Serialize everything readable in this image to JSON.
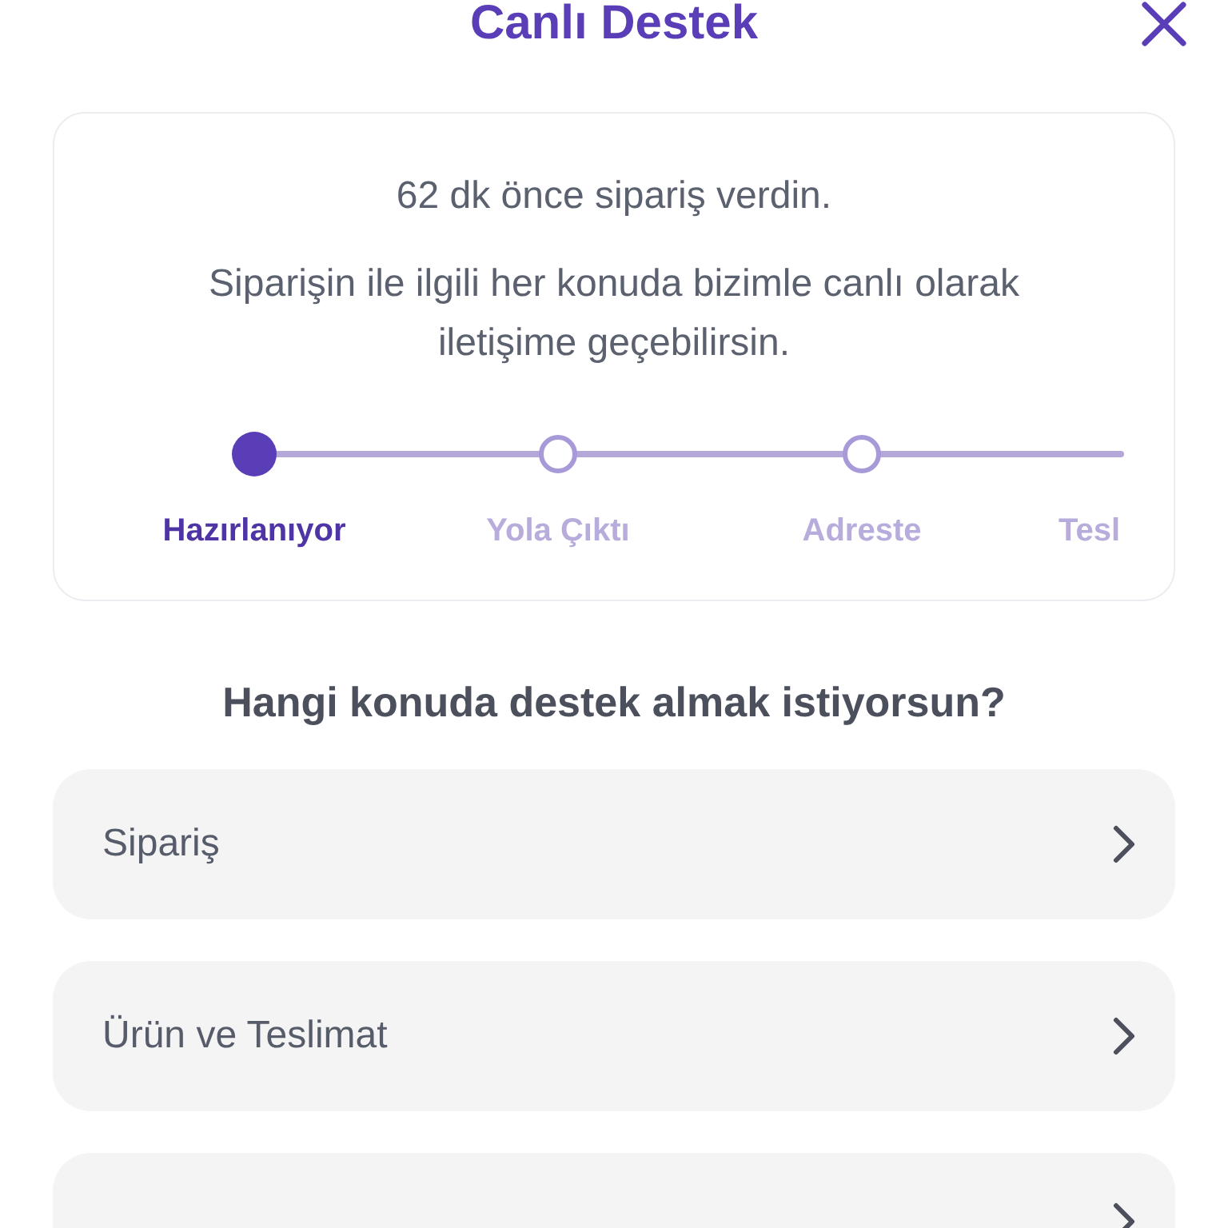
{
  "header": {
    "title": "Canlı Destek"
  },
  "order_card": {
    "time_text": "62 dk önce sipariş verdin.",
    "description": "Siparişin ile ilgili her konuda bizimle canlı olarak iletişime geçebilirsin.",
    "steps": [
      {
        "label": "Hazırlanıyor",
        "selected": true
      },
      {
        "label": "Yola Çıktı",
        "selected": false
      },
      {
        "label": "Adreste",
        "selected": false
      },
      {
        "label": "Tesl",
        "selected": false
      }
    ]
  },
  "topics_heading": "Hangi konuda destek almak istiyorsun?",
  "topics": [
    {
      "label": "Sipariş"
    },
    {
      "label": "Ürün ve Teslimat"
    },
    {
      "kind": "cut"
    }
  ]
}
